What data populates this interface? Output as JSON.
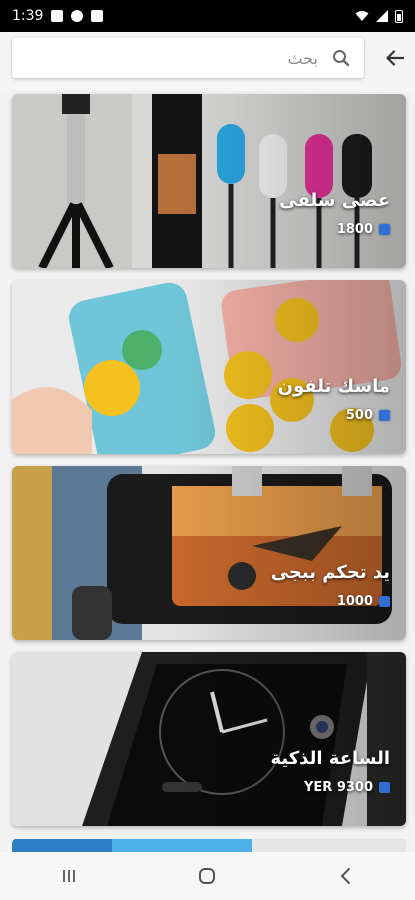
{
  "status_bar": {
    "time": "1:39"
  },
  "search": {
    "placeholder": "بحث"
  },
  "products": [
    {
      "title": "عصى سلفى",
      "price": "1800"
    },
    {
      "title": "ماسك تلفون",
      "price": "500"
    },
    {
      "title": "يد تحكم ببجى",
      "price": "1000"
    },
    {
      "title": "الساعة الذكية",
      "price": "YER 9300"
    }
  ],
  "colors": {
    "accent": "#2f6fd6",
    "background": "#f2f2f2"
  }
}
